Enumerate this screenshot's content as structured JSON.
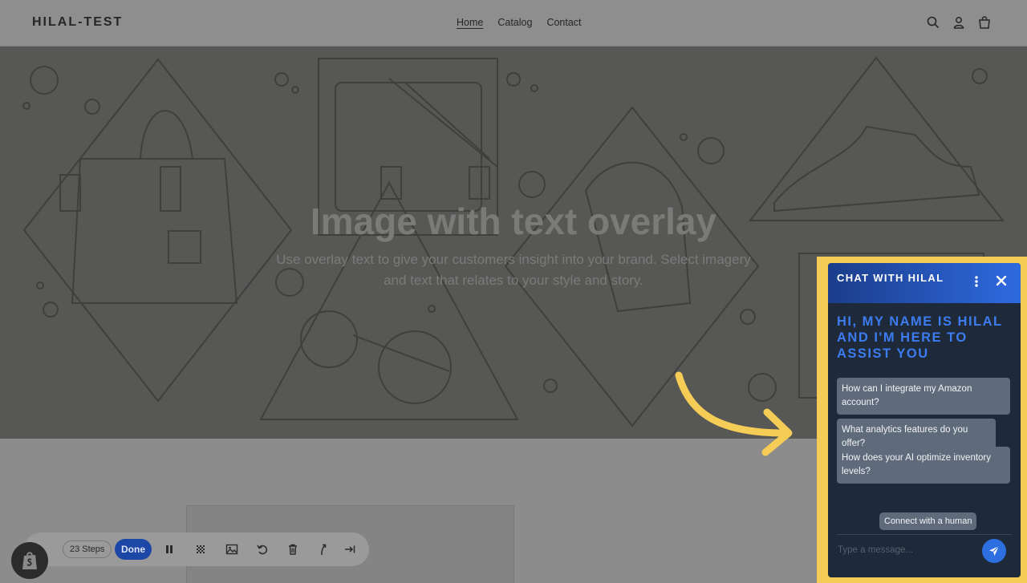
{
  "header": {
    "logo": "HILAL-TEST",
    "nav": [
      {
        "label": "Home",
        "active": true
      },
      {
        "label": "Catalog",
        "active": false
      },
      {
        "label": "Contact",
        "active": false
      }
    ],
    "icons": [
      "search-icon",
      "account-icon",
      "cart-icon"
    ]
  },
  "hero": {
    "title": "Image with text overlay",
    "text": "Use overlay text to give your customers insight into your brand. Select imagery and text that relates to your style and story."
  },
  "toolbar": {
    "steps_label": "23 Steps",
    "done_label": "Done",
    "icons": [
      "shopify-icon",
      "pause-icon",
      "blur-icon",
      "image-icon",
      "undo-icon",
      "trash-icon",
      "branch-icon",
      "skip-to-end-icon"
    ]
  },
  "chat": {
    "title": "CHAT WITH HILAL",
    "greeting": "HI, MY NAME IS HILAL AND I'M HERE TO ASSIST YOU",
    "suggestions": [
      "How can I integrate my Amazon account?",
      "What analytics features do you offer?",
      "How does your AI optimize inventory levels?"
    ],
    "connect_label": "Connect with a human",
    "input_placeholder": "Type a message...",
    "icons": [
      "kebab-menu-icon",
      "close-icon",
      "send-icon"
    ]
  },
  "colors": {
    "chat_header_start": "#1b3d8a",
    "chat_header_end": "#2e6ae0",
    "chat_body": "#1e2a3a",
    "greeting_text": "#3d7cf0",
    "highlight_frame": "#f5cc55",
    "done_button": "#1d47a6"
  }
}
